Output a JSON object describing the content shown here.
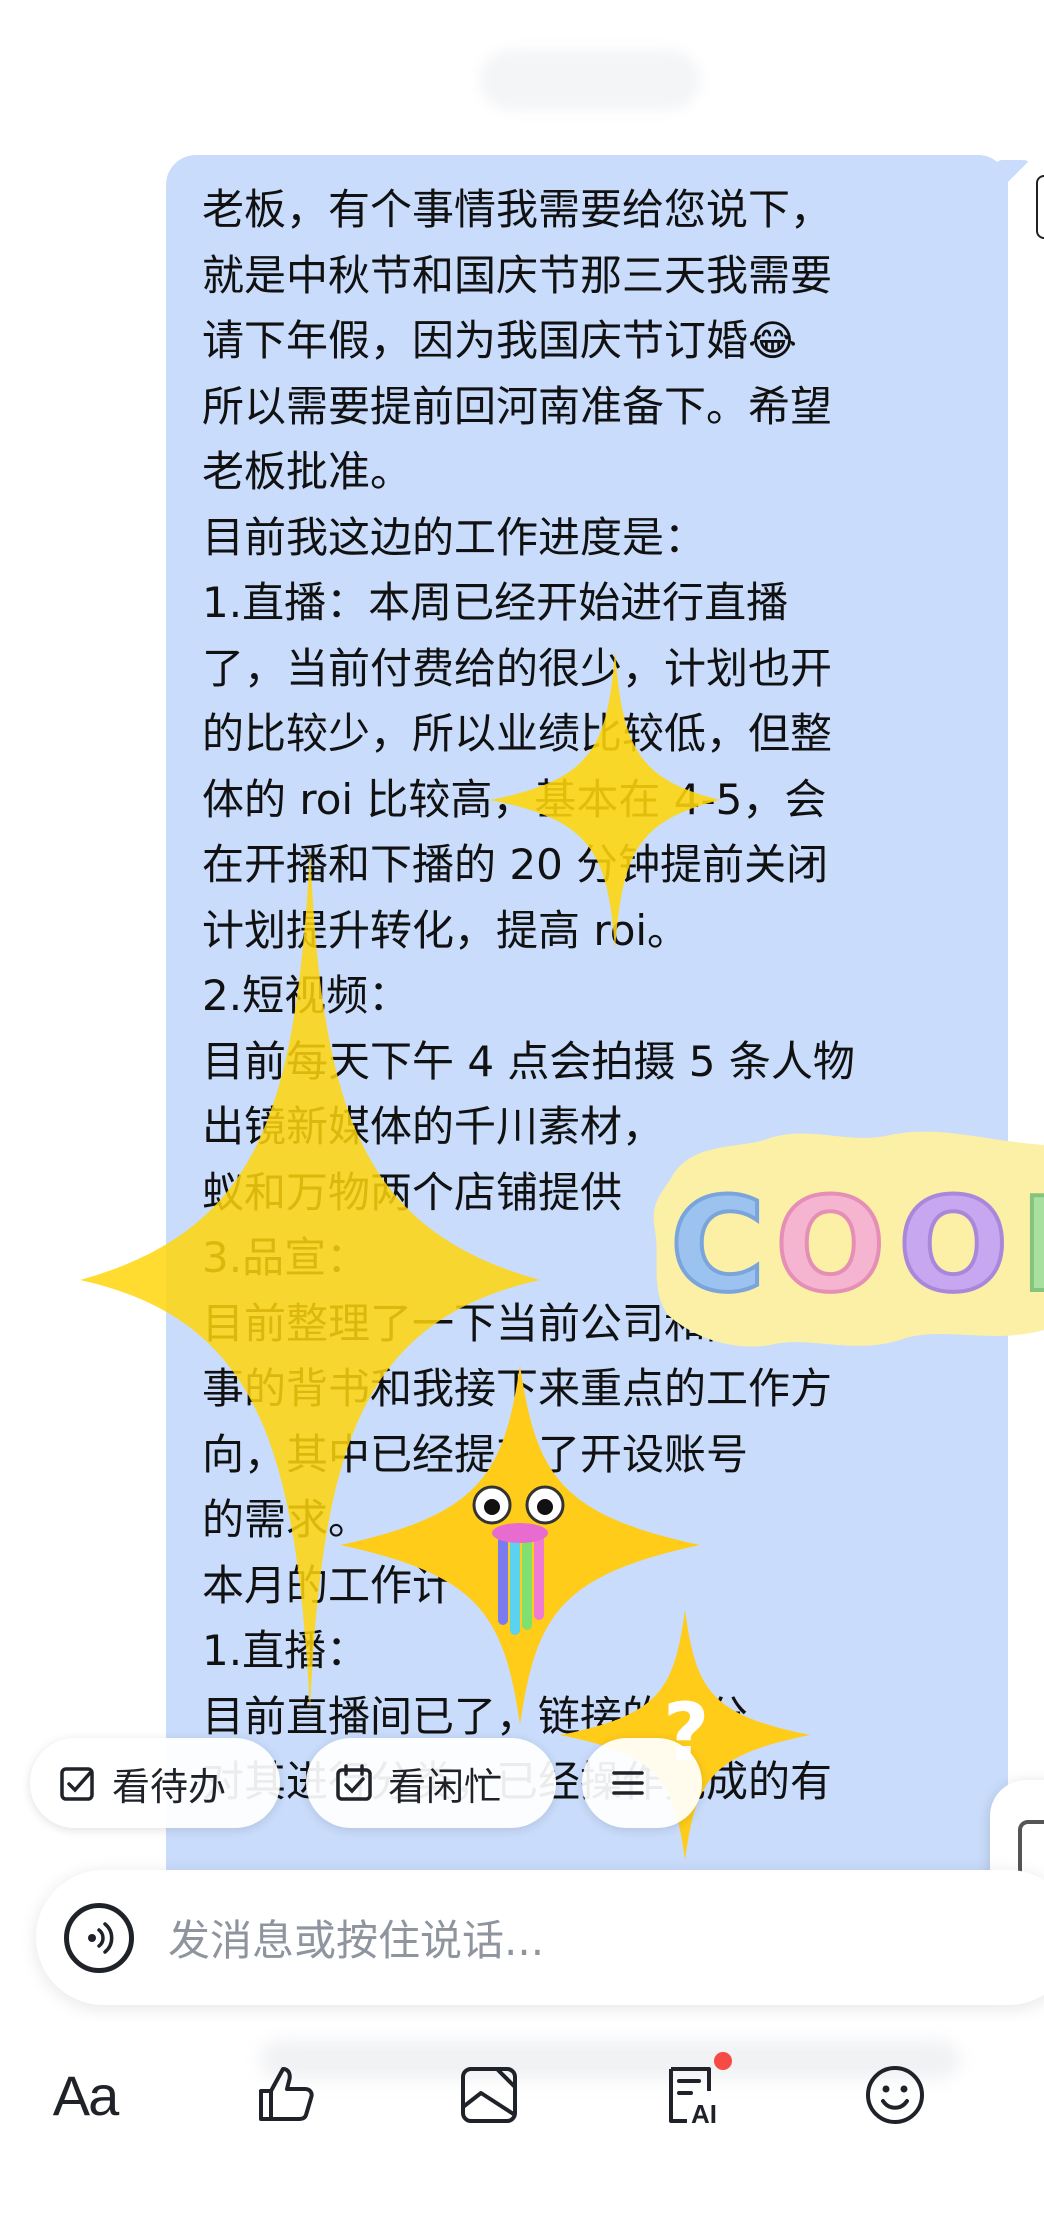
{
  "message": {
    "lines": [
      "老板，有个事情我需要给您说下，",
      "就是中秋节和国庆节那三天我需要",
      "请下年假，因为我国庆节订婚😂",
      "所以需要提前回河南准备下。希望",
      "老板批准。",
      "目前我这边的工作进度是：",
      "1.直播：本周已经开始进行直播",
      "了，当前付费给的很少，计划也开",
      "的比较少，所以业绩比较低，但整",
      "体的 roi 比较高，基本在 4-5，会",
      "在开播和下播的 20 分钟提前关闭",
      "计划提升转化，提高 roi。",
      "2.短视频：",
      "目前每天下午 4 点会拍摄 5 条人物",
      "出镜新媒体的千川素材，",
      "蚁和万物两个店铺提供",
      "3.品宣：",
      "目前整理了一下当前公司和品牌故",
      "事的背书和我接下来重点的工作方",
      "向，其中已经提交了开设账号",
      "的需求。",
      "本月的工作计",
      "1.直播：",
      "目前直播间已了，链接的划分",
      "对其进行分类，已经操作完成的有"
    ]
  },
  "stickers": {
    "cool_text": "COOL"
  },
  "quick_actions": [
    {
      "label": "看待办",
      "icon": "checkbox-icon"
    },
    {
      "label": "看闲忙",
      "icon": "calendar-check-icon"
    },
    {
      "label": "",
      "icon": "menu-icon"
    }
  ],
  "input": {
    "placeholder": "发消息或按住说话..."
  },
  "toolbar": {
    "font_label": "Aa",
    "items": [
      "font-format-icon",
      "thumbs-up-icon",
      "image-icon",
      "ai-compose-icon",
      "emoji-icon"
    ],
    "badge_color": "#f54a45"
  },
  "colors": {
    "bubble": "#c9dcfb",
    "sparkle": "#ffd60a"
  }
}
